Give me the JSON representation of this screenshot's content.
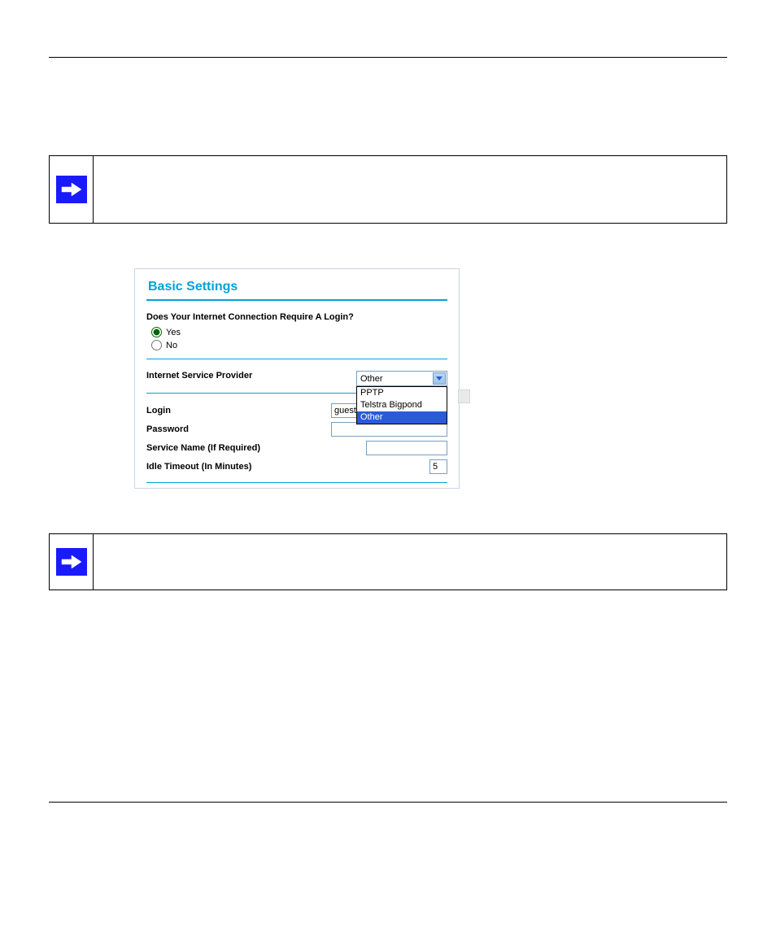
{
  "panel": {
    "title": "Basic Settings",
    "question": "Does Your Internet Connection Require A Login?",
    "yes_label": "Yes",
    "no_label": "No",
    "isp_label": "Internet Service Provider",
    "login_label": "Login",
    "login_value": "guest",
    "password_label": "Password",
    "service_label": "Service Name",
    "service_hint": "(If Required)",
    "idle_label": "Idle Timeout",
    "idle_hint": "(In Minutes)",
    "idle_value": "5",
    "dropdown": {
      "selected": "Other",
      "options": [
        "PPTP",
        "Telstra Bigpond",
        "Other"
      ]
    }
  }
}
